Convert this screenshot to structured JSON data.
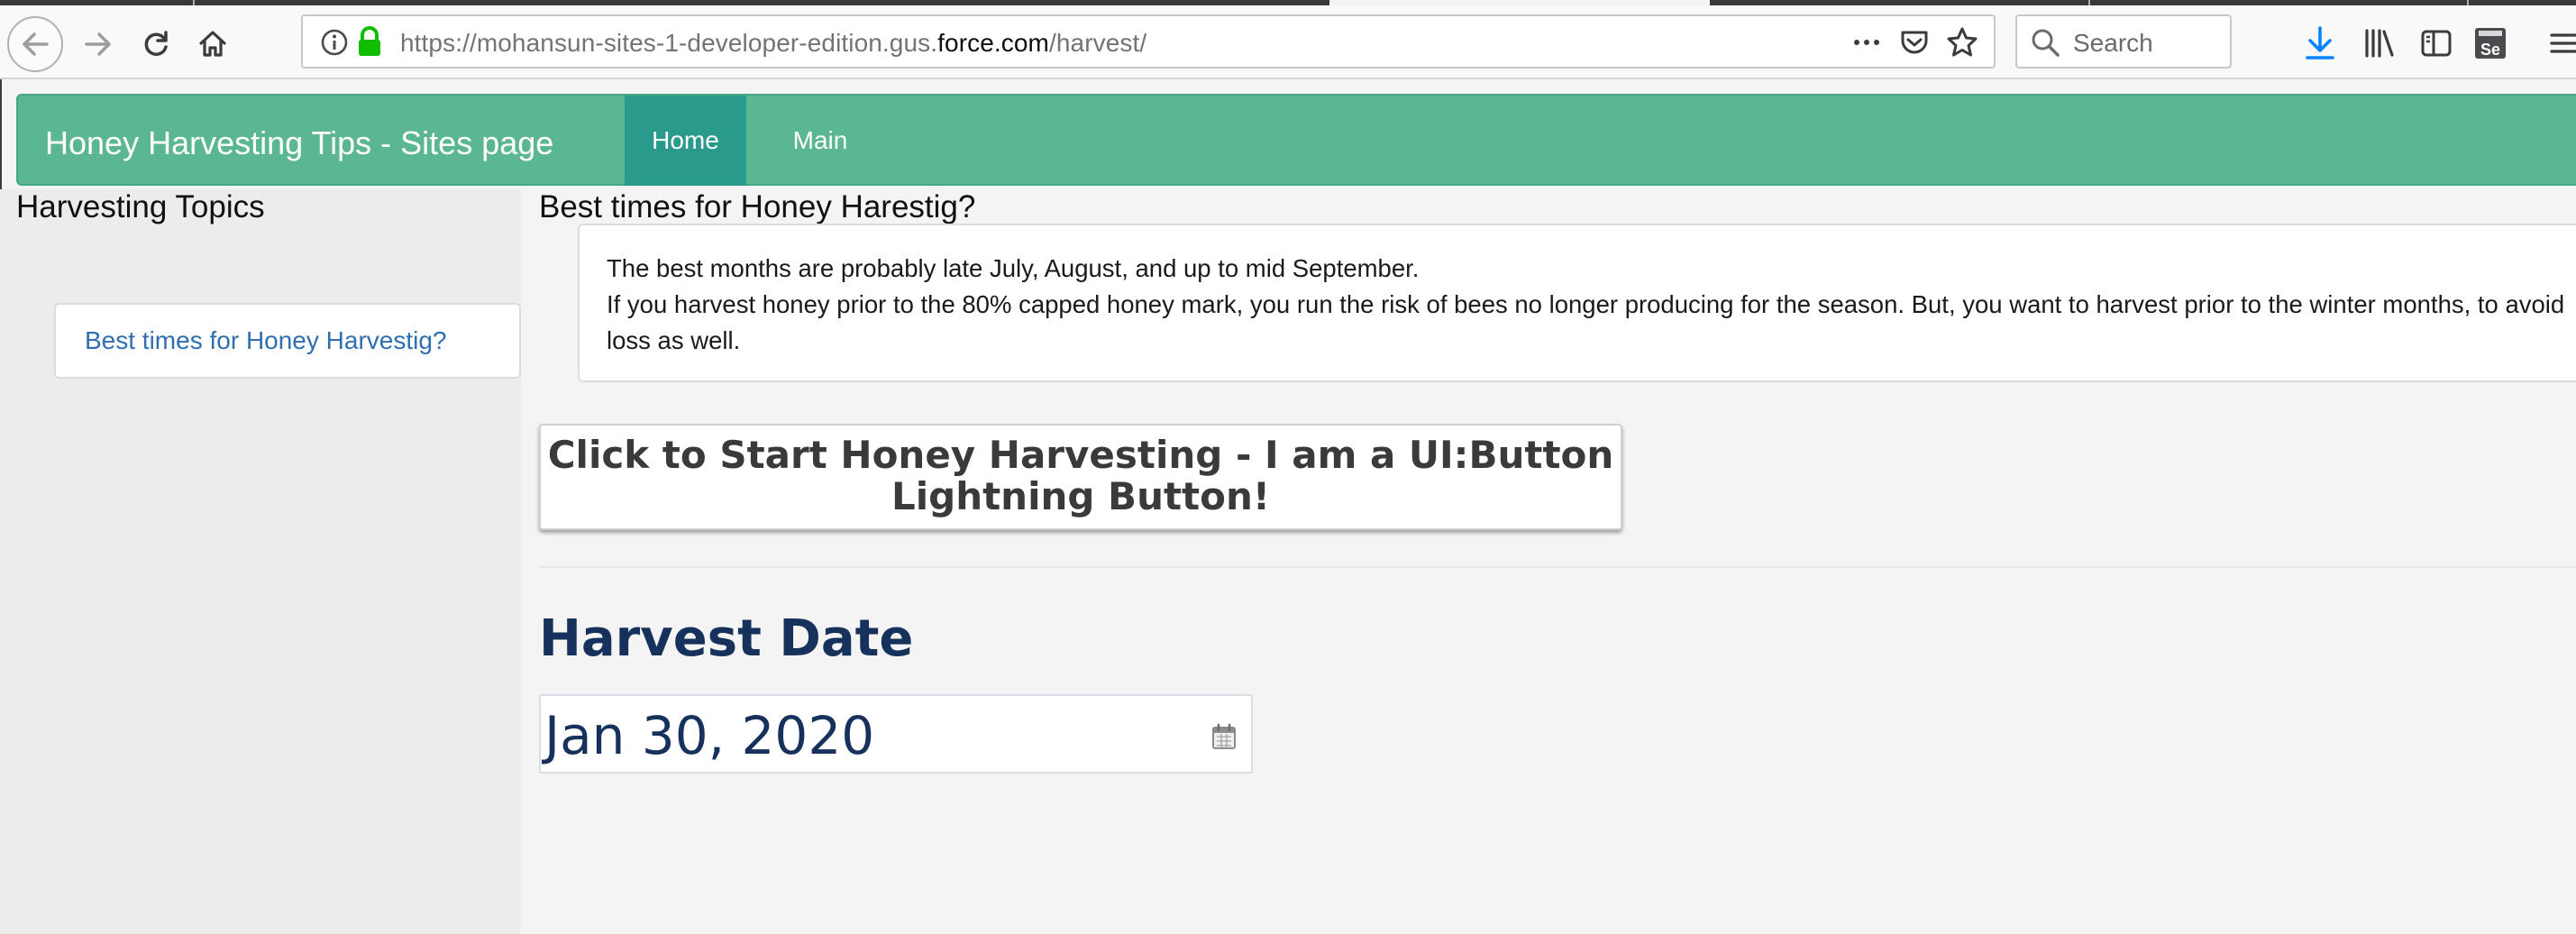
{
  "browser": {
    "url_prefix": "https://mohansun-sites-1-developer-edition.gus.",
    "url_host": "force.com",
    "url_suffix": "/harvest/",
    "search_placeholder": "Search"
  },
  "site": {
    "title": "Honey Harvesting Tips - Sites page",
    "nav": {
      "home": "Home",
      "main": "Main"
    },
    "accent_color": "#5bb792",
    "active_tab_color": "#2a9a8c"
  },
  "sidebar": {
    "title": "Harvesting Topics",
    "items": [
      {
        "label": "Best times for Honey Harvestig?"
      }
    ]
  },
  "article": {
    "title": "Best times for Honey Harestig?",
    "lines": [
      "The best months are probably late July, August, and up to mid September.",
      "If you harvest honey prior to the 80% capped honey mark, you run the risk of bees no longer producing for the season. But, you want to harvest prior to the winter months, to avoid loss as well."
    ]
  },
  "harvest_button": {
    "line1": "Click to Start Honey Harvesting - I am a UI:Button",
    "line2": "Lightning Button!"
  },
  "harvest_date": {
    "label": "Harvest Date",
    "value": "Jan 30, 2020"
  }
}
